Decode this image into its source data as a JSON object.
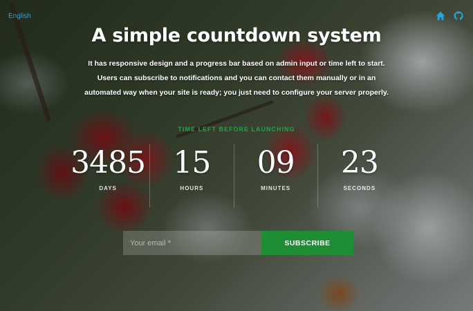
{
  "header": {
    "language_label": "English",
    "icons": [
      "home-icon",
      "github-icon"
    ],
    "icon_color": "#2aa3d8"
  },
  "hero": {
    "title": "A simple countdown system",
    "description": "It has responsive design and a progress bar based on admin input or time left to start. Users can subscribe to notifications and you can contact them manually or in an automated way when your site is ready; you just need to configure your server properly."
  },
  "countdown": {
    "caption": "TIME LEFT BEFORE LAUNCHING",
    "caption_color": "#27a046",
    "units": [
      {
        "value": "3485",
        "label": "DAYS"
      },
      {
        "value": "15",
        "label": "HOURS"
      },
      {
        "value": "09",
        "label": "MINUTES"
      },
      {
        "value": "23",
        "label": "SECONDS"
      }
    ]
  },
  "subscribe": {
    "email_placeholder": "Your email *",
    "button_label": "SUBSCRIBE",
    "button_color": "#1e8d34"
  }
}
